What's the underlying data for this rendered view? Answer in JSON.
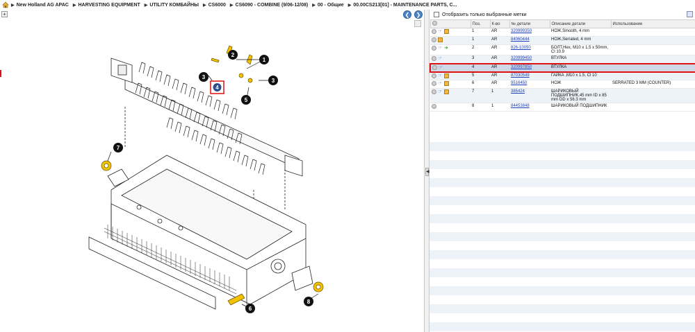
{
  "breadcrumb": [
    "New Holland AG APAC",
    "HARVESTING EQUIPMENT",
    "UTILITY КОМБАЙНЫ",
    "CS6000",
    "CS6090 - COMBINE (9/06-12/08)",
    "00 - Общие",
    "00.00CS213[01] - MAINTENANCE PARTS, C..."
  ],
  "left_toolbar": {
    "expand_symbol": "+",
    "prev_symbol": "❮",
    "next_symbol": "❯"
  },
  "callouts": [
    "1",
    "2",
    "3",
    "3",
    "4",
    "5",
    "6",
    "7",
    "8"
  ],
  "right_panel": {
    "filter_label": "Отобразить только выбранные метки",
    "columns": [
      "",
      "Поз.",
      "К-во",
      "№ детали",
      "Описание детали",
      "Использование"
    ],
    "rows": [
      {
        "pos": "1",
        "qty": "AR",
        "part_no": "320999350",
        "desc": "НОЖ,Smooth, 4 mm",
        "usage": "",
        "icons": [
          "plus",
          "hand",
          "box"
        ]
      },
      {
        "pos": "1",
        "qty": "AR",
        "part_no": "84060444",
        "desc": "НОЖ,Serrated, 4 mm",
        "usage": "",
        "icons": [
          "plus",
          "box"
        ]
      },
      {
        "pos": "2",
        "qty": "AR",
        "part_no": "826-10050",
        "desc": "БОЛТ,Hex, M10 x 1.5 x 50mm, Cl 10.9",
        "usage": "",
        "icons": [
          "plus",
          "hand",
          "arrow"
        ]
      },
      {
        "pos": "3",
        "qty": "AR",
        "part_no": "320999450",
        "desc": "ВТУЛКА",
        "usage": "",
        "icons": [
          "plus",
          "hand"
        ]
      },
      {
        "pos": "4",
        "qty": "AR",
        "part_no": "320997850",
        "desc": "ВТУЛКА",
        "usage": "",
        "icons": [
          "plus",
          "hand"
        ],
        "selected": true
      },
      {
        "pos": "5",
        "qty": "AR",
        "part_no": "87030549",
        "desc": "ГАЙКА ,M10 x 1.5, Cl 10",
        "usage": "",
        "icons": [
          "plus",
          "hand",
          "box"
        ]
      },
      {
        "pos": "6",
        "qty": "AR",
        "part_no": "9516450",
        "desc": "НОЖ",
        "usage": "SERRATED 3 MM (COUNTER)",
        "icons": [
          "plus",
          "hand",
          "box"
        ]
      },
      {
        "pos": "7",
        "qty": "1",
        "part_no": "385424",
        "desc": "ШАРИКОВЫЙ ПОДШИПНИК,45 mm ID x 85 mm OD x 56.3 mm",
        "usage": "",
        "icons": [
          "plus",
          "hand",
          "box"
        ]
      },
      {
        "pos": "8",
        "qty": "1",
        "part_no": "84453848",
        "desc": "ШАРИКОВЫЙ ПОДШИПНИК",
        "usage": "",
        "icons": [
          "plus"
        ]
      }
    ]
  },
  "colors": {
    "highlight_red": "#dd1111",
    "link_blue": "#1a3fb8",
    "part_yellow": "#f2c200",
    "nav_blue": "#4a86c8"
  },
  "icons": {
    "home": "home-icon",
    "export": "export-icon",
    "collapse": "collapse-panel-icon"
  }
}
